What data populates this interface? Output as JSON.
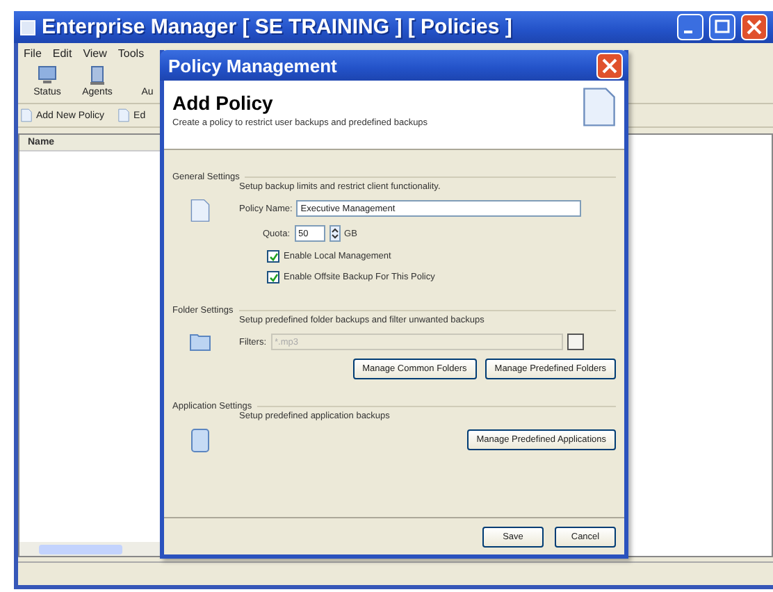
{
  "window": {
    "title": "Enterprise Manager [ SE TRAINING ] [ Policies ]"
  },
  "menu": [
    "File",
    "Edit",
    "View",
    "Tools"
  ],
  "toolbar": [
    {
      "label": "Status",
      "kind": "status"
    },
    {
      "label": "Agents",
      "kind": "agents"
    },
    {
      "label": "Au",
      "kind": "other"
    }
  ],
  "policy_toolbar": [
    "Add New Policy",
    "Ed"
  ],
  "list": {
    "columns": [
      "Name"
    ]
  },
  "dialog": {
    "title": "Policy Management",
    "heading": "Add Policy",
    "subtitle": "Create a policy to restrict user backups and predefined backups",
    "sections": [
      {
        "kind": "general",
        "title": "General Settings",
        "description": "Setup backup limits and restrict client functionality.",
        "policy_name": {
          "label": "Policy Name:",
          "value": "Executive Management"
        },
        "quota": {
          "label": "Quota:",
          "value": "50",
          "unit": "GB"
        },
        "checkboxes": [
          {
            "label": "Enable Local Management",
            "checked": true
          },
          {
            "label": "Enable Offsite Backup For This Policy",
            "checked": true
          }
        ]
      },
      {
        "kind": "folder",
        "title": "Folder Settings",
        "description": "Setup predefined folder backups and filter unwanted backups",
        "filters": {
          "label": "Filters:",
          "value": "*.mp3",
          "disabled": true
        },
        "buttons": [
          "Manage Common Folders",
          "Manage Predefined Folders"
        ]
      },
      {
        "kind": "application",
        "title": "Application Settings",
        "description": "Setup predefined application backups",
        "buttons": [
          "Manage Predefined Applications"
        ]
      }
    ],
    "buttons": [
      "Save",
      "Cancel"
    ]
  }
}
